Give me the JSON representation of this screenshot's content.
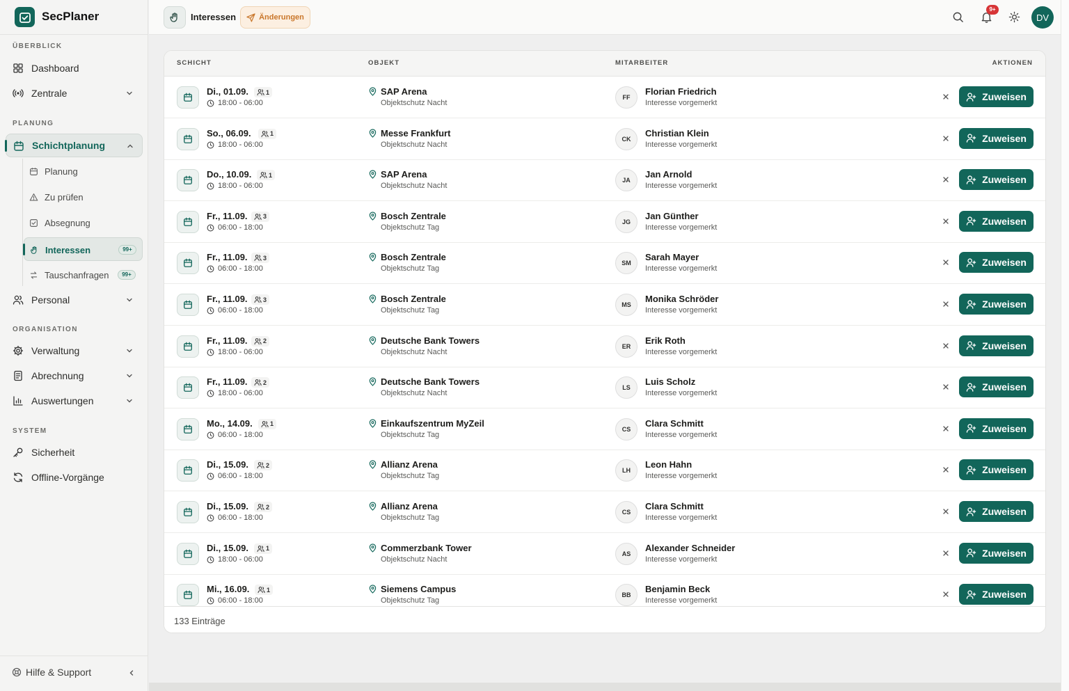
{
  "app": {
    "name": "SecPlaner"
  },
  "sidebar": {
    "sections": [
      "ÜBERBLICK",
      "PLANUNG",
      "ORGANISATION",
      "SYSTEM"
    ],
    "items": {
      "dashboard": "Dashboard",
      "zentrale": "Zentrale",
      "schichtplanung": "Schichtplanung",
      "planung": "Planung",
      "zu_pruefen": "Zu prüfen",
      "absegnung": "Absegnung",
      "interessen": "Interessen",
      "tauschanfragen": "Tauschanfragen",
      "personal": "Personal",
      "verwaltung": "Verwaltung",
      "abrechnung": "Abrechnung",
      "auswertungen": "Auswertungen",
      "sicherheit": "Sicherheit",
      "offline": "Offline-Vorgänge"
    },
    "badges": {
      "interessen": "99+",
      "tauschanfragen": "99+"
    },
    "help": "Hilfe & Support"
  },
  "topbar": {
    "title": "Interessen",
    "changes_label": "Änderungen",
    "notification_badge": "9+",
    "user_initials": "DV"
  },
  "table": {
    "headers": {
      "shift": "SCHICHT",
      "object": "OBJEKT",
      "employee": "MITARBEITER",
      "actions": "AKTIONEN"
    },
    "assign_label": "Zuweisen",
    "rows": [
      {
        "date": "Di., 01.09.",
        "people": "1",
        "time": "18:00 - 06:00",
        "object": "SAP Arena",
        "object_type": "Objektschutz Nacht",
        "initials": "FF",
        "employee": "Florian Friedrich",
        "status": "Interesse vorgemerkt"
      },
      {
        "date": "So., 06.09.",
        "people": "1",
        "time": "18:00 - 06:00",
        "object": "Messe Frankfurt",
        "object_type": "Objektschutz Nacht",
        "initials": "CK",
        "employee": "Christian Klein",
        "status": "Interesse vorgemerkt"
      },
      {
        "date": "Do., 10.09.",
        "people": "1",
        "time": "18:00 - 06:00",
        "object": "SAP Arena",
        "object_type": "Objektschutz Nacht",
        "initials": "JA",
        "employee": "Jan Arnold",
        "status": "Interesse vorgemerkt"
      },
      {
        "date": "Fr., 11.09.",
        "people": "3",
        "time": "06:00 - 18:00",
        "object": "Bosch Zentrale",
        "object_type": "Objektschutz Tag",
        "initials": "JG",
        "employee": "Jan Günther",
        "status": "Interesse vorgemerkt"
      },
      {
        "date": "Fr., 11.09.",
        "people": "3",
        "time": "06:00 - 18:00",
        "object": "Bosch Zentrale",
        "object_type": "Objektschutz Tag",
        "initials": "SM",
        "employee": "Sarah Mayer",
        "status": "Interesse vorgemerkt"
      },
      {
        "date": "Fr., 11.09.",
        "people": "3",
        "time": "06:00 - 18:00",
        "object": "Bosch Zentrale",
        "object_type": "Objektschutz Tag",
        "initials": "MS",
        "employee": "Monika Schröder",
        "status": "Interesse vorgemerkt"
      },
      {
        "date": "Fr., 11.09.",
        "people": "2",
        "time": "18:00 - 06:00",
        "object": "Deutsche Bank Towers",
        "object_type": "Objektschutz Nacht",
        "initials": "ER",
        "employee": "Erik Roth",
        "status": "Interesse vorgemerkt"
      },
      {
        "date": "Fr., 11.09.",
        "people": "2",
        "time": "18:00 - 06:00",
        "object": "Deutsche Bank Towers",
        "object_type": "Objektschutz Nacht",
        "initials": "LS",
        "employee": "Luis Scholz",
        "status": "Interesse vorgemerkt"
      },
      {
        "date": "Mo., 14.09.",
        "people": "1",
        "time": "06:00 - 18:00",
        "object": "Einkaufszentrum MyZeil",
        "object_type": "Objektschutz Tag",
        "initials": "CS",
        "employee": "Clara Schmitt",
        "status": "Interesse vorgemerkt"
      },
      {
        "date": "Di., 15.09.",
        "people": "2",
        "time": "06:00 - 18:00",
        "object": "Allianz Arena",
        "object_type": "Objektschutz Tag",
        "initials": "LH",
        "employee": "Leon Hahn",
        "status": "Interesse vorgemerkt"
      },
      {
        "date": "Di., 15.09.",
        "people": "2",
        "time": "06:00 - 18:00",
        "object": "Allianz Arena",
        "object_type": "Objektschutz Tag",
        "initials": "CS",
        "employee": "Clara Schmitt",
        "status": "Interesse vorgemerkt"
      },
      {
        "date": "Di., 15.09.",
        "people": "1",
        "time": "18:00 - 06:00",
        "object": "Commerzbank Tower",
        "object_type": "Objektschutz Nacht",
        "initials": "AS",
        "employee": "Alexander Schneider",
        "status": "Interesse vorgemerkt"
      },
      {
        "date": "Mi., 16.09.",
        "people": "1",
        "time": "06:00 - 18:00",
        "object": "Siemens Campus",
        "object_type": "Objektschutz Tag",
        "initials": "BB",
        "employee": "Benjamin Beck",
        "status": "Interesse vorgemerkt"
      }
    ],
    "total": "133 Einträge"
  },
  "colors": {
    "accent": "#12665a",
    "warning": "#c9762a",
    "notification": "#d73537"
  },
  "icons": [
    "logo-check-icon",
    "dashboard-icon",
    "broadcast-icon",
    "calendar-icon",
    "alert-icon",
    "check-square-icon",
    "hand-icon",
    "swap-icon",
    "users-icon",
    "gear-icon",
    "document-icon",
    "bar-chart-icon",
    "key-icon",
    "refresh-icon",
    "help-icon",
    "chevron-down-icon",
    "chevron-up-icon",
    "chevron-left-icon",
    "send-icon",
    "search-icon",
    "bell-icon",
    "sun-icon",
    "clock-icon",
    "people-icon",
    "map-pin-icon",
    "close-icon",
    "user-plus-icon"
  ]
}
